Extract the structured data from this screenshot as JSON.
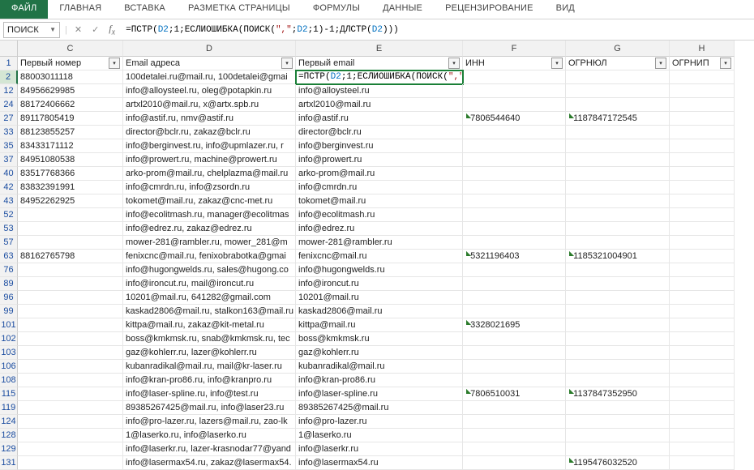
{
  "tabs": {
    "file": "ФАЙЛ",
    "home": "ГЛАВНАЯ",
    "insert": "ВСТАВКА",
    "layout": "РАЗМЕТКА СТРАНИЦЫ",
    "formulas": "ФОРМУЛЫ",
    "data": "ДАННЫЕ",
    "review": "РЕЦЕНЗИРОВАНИЕ",
    "view": "ВИД"
  },
  "namebox": "ПОИСК",
  "formula_plain": "=ПСТР(D2;1;ЕСЛИОШИБКА(ПОИСК(\",\";D2;1)-1;ДЛСТР(D2)))",
  "columns": [
    "C",
    "D",
    "E",
    "F",
    "G",
    "H"
  ],
  "headers": {
    "C": "Первый номер",
    "D": "Email адреса",
    "E": "Первый email",
    "F": "ИНН",
    "G": "ОГРНЮЛ",
    "H": "ОГРНИП"
  },
  "active_row": "2",
  "rows": [
    {
      "n": "2",
      "C": "88003011118",
      "D": "100detalei.ru@mail.ru, 100detalei@gmai",
      "E": "=ПСТР(D2;1;ЕСЛИОШИБКА(ПОИСК(\",\";D2;1)-1;ДЛСТР(D2)))",
      "F": "",
      "G": ""
    },
    {
      "n": "12",
      "C": "84956629985",
      "D": "info@alloysteel.ru, oleg@potapkin.ru",
      "E": "info@alloysteel.ru",
      "F": "",
      "G": ""
    },
    {
      "n": "24",
      "C": "88172406662",
      "D": "artxl2010@mail.ru, x@artx.spb.ru",
      "E": "artxl2010@mail.ru",
      "F": "",
      "G": ""
    },
    {
      "n": "27",
      "C": "89117805419",
      "D": "info@astif.ru, nmv@astif.ru",
      "E": "info@astif.ru",
      "F": "7806544640",
      "G": "1187847172545"
    },
    {
      "n": "33",
      "C": "88123855257",
      "D": "director@bclr.ru, zakaz@bclr.ru",
      "E": "director@bclr.ru",
      "F": "",
      "G": ""
    },
    {
      "n": "35",
      "C": "83433171112",
      "D": "info@berginvest.ru, info@upmlazer.ru, r",
      "E": "info@berginvest.ru",
      "F": "",
      "G": ""
    },
    {
      "n": "37",
      "C": "84951080538",
      "D": "info@prowert.ru, machine@prowert.ru",
      "E": "info@prowert.ru",
      "F": "",
      "G": ""
    },
    {
      "n": "40",
      "C": "83517768366",
      "D": "arko-prom@mail.ru, chelplazma@mail.ru",
      "E": "arko-prom@mail.ru",
      "F": "",
      "G": ""
    },
    {
      "n": "42",
      "C": "83832391991",
      "D": "info@cmrdn.ru, info@zsordn.ru",
      "E": "info@cmrdn.ru",
      "F": "",
      "G": ""
    },
    {
      "n": "43",
      "C": "84952262925",
      "D": "tokomet@mail.ru, zakaz@cnc-met.ru",
      "E": "tokomet@mail.ru",
      "F": "",
      "G": ""
    },
    {
      "n": "52",
      "C": "",
      "D": "info@ecolitmash.ru, manager@ecolitmas",
      "E": "info@ecolitmash.ru",
      "F": "",
      "G": ""
    },
    {
      "n": "53",
      "C": "",
      "D": "info@edrez.ru, zakaz@edrez.ru",
      "E": "info@edrez.ru",
      "F": "",
      "G": ""
    },
    {
      "n": "57",
      "C": "",
      "D": "mower-281@rambler.ru, mower_281@m",
      "E": "mower-281@rambler.ru",
      "F": "",
      "G": ""
    },
    {
      "n": "63",
      "C": "88162765798",
      "D": "fenixcnc@mail.ru, fenixobrabotka@gmai",
      "E": "fenixcnc@mail.ru",
      "F": "5321196403",
      "G": "1185321004901"
    },
    {
      "n": "76",
      "C": "",
      "D": "info@hugongwelds.ru, sales@hugong.co",
      "E": "info@hugongwelds.ru",
      "F": "",
      "G": ""
    },
    {
      "n": "89",
      "C": "",
      "D": "info@ironcut.ru, mail@ironcut.ru",
      "E": "info@ironcut.ru",
      "F": "",
      "G": ""
    },
    {
      "n": "96",
      "C": "",
      "D": "10201@mail.ru, 641282@gmail.com",
      "E": "10201@mail.ru",
      "F": "",
      "G": ""
    },
    {
      "n": "99",
      "C": "",
      "D": "kaskad2806@mail.ru, stalkon163@mail.ru",
      "E": "kaskad2806@mail.ru",
      "F": "",
      "G": ""
    },
    {
      "n": "101",
      "C": "",
      "D": "kittpa@mail.ru, zakaz@kit-metal.ru",
      "E": "kittpa@mail.ru",
      "F": "3328021695",
      "G": ""
    },
    {
      "n": "102",
      "C": "",
      "D": "boss@kmkmsk.ru, snab@kmkmsk.ru, tec",
      "E": "boss@kmkmsk.ru",
      "F": "",
      "G": ""
    },
    {
      "n": "103",
      "C": "",
      "D": "gaz@kohlerr.ru, lazer@kohlerr.ru",
      "E": "gaz@kohlerr.ru",
      "F": "",
      "G": ""
    },
    {
      "n": "106",
      "C": "",
      "D": "kubanradikal@mail.ru, mail@kr-laser.ru",
      "E": "kubanradikal@mail.ru",
      "F": "",
      "G": ""
    },
    {
      "n": "108",
      "C": "",
      "D": "info@kran-pro86.ru, info@kranpro.ru",
      "E": "info@kran-pro86.ru",
      "F": "",
      "G": ""
    },
    {
      "n": "115",
      "C": "",
      "D": "info@laser-spline.ru, info@test.ru",
      "E": "info@laser-spline.ru",
      "F": "7806510031",
      "G": "1137847352950"
    },
    {
      "n": "119",
      "C": "",
      "D": "89385267425@mail.ru, info@laser23.ru",
      "E": "89385267425@mail.ru",
      "F": "",
      "G": ""
    },
    {
      "n": "124",
      "C": "",
      "D": "info@pro-lazer.ru, lazers@mail.ru, zao-lk",
      "E": "info@pro-lazer.ru",
      "F": "",
      "G": ""
    },
    {
      "n": "128",
      "C": "",
      "D": "1@laserko.ru, info@laserko.ru",
      "E": "1@laserko.ru",
      "F": "",
      "G": ""
    },
    {
      "n": "129",
      "C": "",
      "D": "info@laserkr.ru, lazer-krasnodar77@yand",
      "E": "info@laserkr.ru",
      "F": "",
      "G": ""
    },
    {
      "n": "131",
      "C": "",
      "D": "info@lasermax54.ru, zakaz@lasermax54.",
      "E": "info@lasermax54.ru",
      "F": "",
      "G": "1195476032520"
    }
  ]
}
